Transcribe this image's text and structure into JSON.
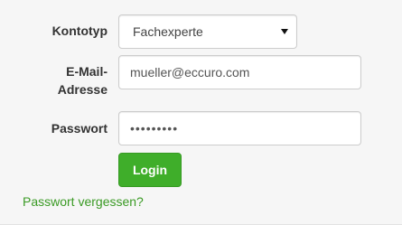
{
  "form": {
    "account_type_label": "Kontotyp",
    "account_type_value": "Fachexperte",
    "email_label_line1": "E-Mail-",
    "email_label_line2": "Adresse",
    "email_value": "mueller@eccuro.com",
    "password_label": "Passwort",
    "password_value": "•••••••••",
    "login_label": "Login",
    "forgot_label": "Passwort vergessen?"
  },
  "colors": {
    "login_button": "#3fae2a",
    "link": "#3a9a24",
    "background": "#f6f6f6"
  },
  "icons": {
    "select_caret": "chevron-down-icon"
  }
}
